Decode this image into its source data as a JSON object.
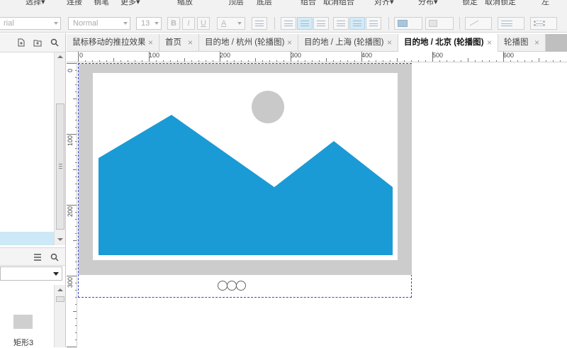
{
  "menubar": {
    "items": [
      "选择▾",
      "连接",
      "钢笔",
      "更多▾",
      "缩放",
      "顶层",
      "底层",
      "组合",
      "取消组合",
      "对齐▾",
      "分布▾",
      "锁定",
      "取消锁定",
      "左"
    ]
  },
  "format_toolbar": {
    "font_family_value": "rial",
    "font_style_value": "Normal",
    "font_size_value": "13",
    "bold_label": "B",
    "italic_label": "I",
    "underline_label": "U",
    "font_color_label": "A"
  },
  "left_panel": {
    "widget_label": "矩形3"
  },
  "tabs": [
    {
      "label": "鼠标移动的推拉效果",
      "active": false
    },
    {
      "label": "首页",
      "active": false
    },
    {
      "label": "目的地 / 杭州 (轮播图)",
      "active": false
    },
    {
      "label": "目的地 / 上海 (轮播图)",
      "active": false
    },
    {
      "label": "目的地 / 北京 (轮播图)",
      "active": true
    },
    {
      "label": "轮播图",
      "active": false
    }
  ],
  "tab_close_glyph": "×",
  "ruler": {
    "h_labels": [
      "0",
      "100",
      "200",
      "300",
      "400",
      "500",
      "600"
    ],
    "v_labels": [
      "0",
      "100",
      "200",
      "300"
    ]
  },
  "colors": {
    "mountain": "#1a9bd6",
    "sun": "#c9c9c9",
    "frame": "#cccccc",
    "selection_border": "#3a46c8",
    "tab_selected_bg": "#ffffff",
    "panel_selected_row": "#cde8f6"
  },
  "carousel": {
    "dot_count": 3
  }
}
